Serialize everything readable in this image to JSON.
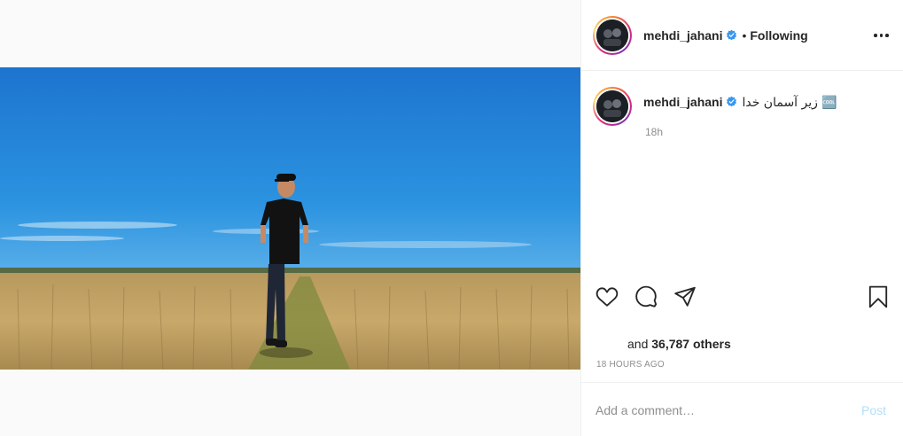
{
  "post": {
    "author": "mehdi_jahani",
    "follow_status": "Following",
    "caption": "زیر آسمان خدا 🆒",
    "caption_time": "18h",
    "likes_prefix": "and",
    "likes_count": "36,787 others",
    "timestamp": "18 HOURS AGO"
  },
  "comment": {
    "placeholder": "Add a comment…",
    "post_label": "Post"
  },
  "icons": {
    "verified": "verified-badge-icon",
    "more": "more-options-icon",
    "like": "heart-icon",
    "comment": "comment-icon",
    "share": "share-icon",
    "save": "bookmark-icon"
  },
  "colors": {
    "verified_blue": "#3897f0",
    "post_disabled": "#b2dffc",
    "muted": "#8e8e8e"
  }
}
